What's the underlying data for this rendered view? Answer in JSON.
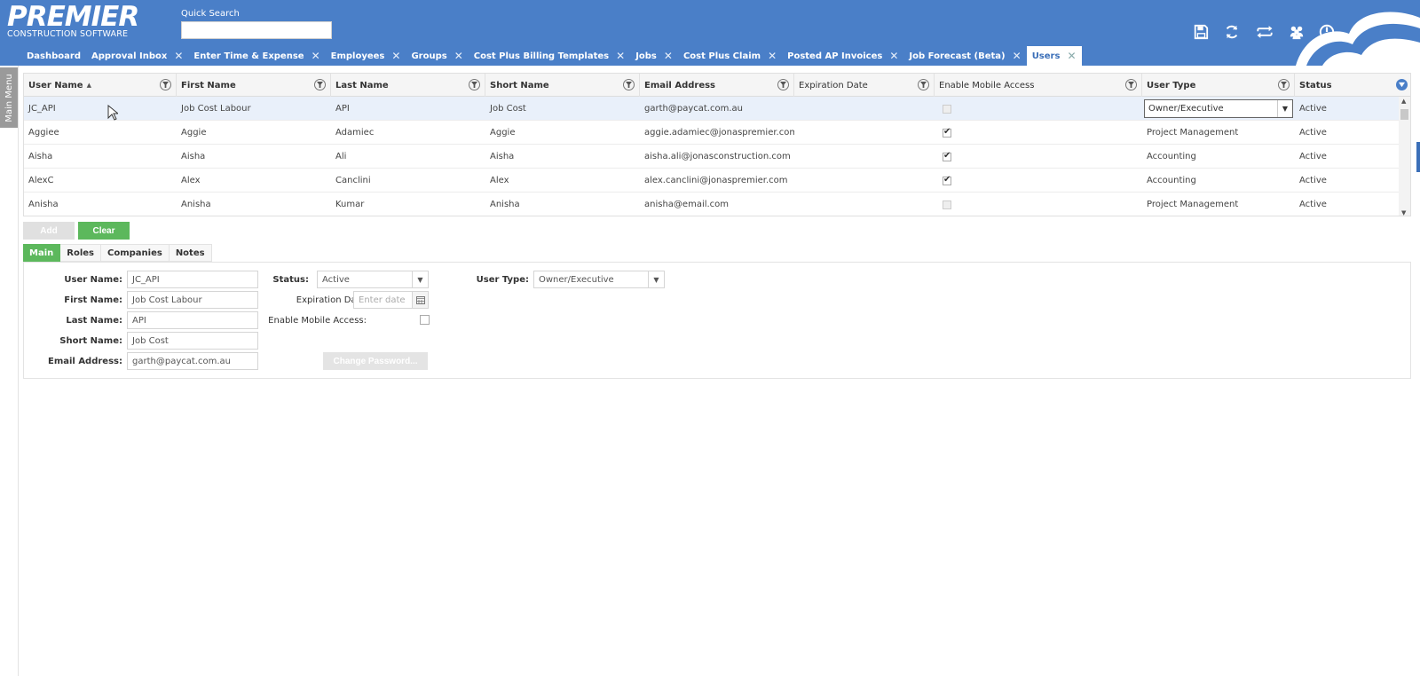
{
  "header": {
    "logo_main": "PREMIER",
    "logo_sub": "CONSTRUCTION SOFTWARE",
    "quick_search_label": "Quick Search",
    "quick_search_value": "",
    "icons": [
      "save-icon",
      "refresh-icon",
      "switch-icon",
      "users-icon",
      "power-icon"
    ],
    "color": "#4a7fc8"
  },
  "tabs": [
    {
      "label": "Dashboard",
      "closable": false
    },
    {
      "label": "Approval Inbox",
      "closable": true
    },
    {
      "label": "Enter Time & Expense",
      "closable": true
    },
    {
      "label": "Employees",
      "closable": true
    },
    {
      "label": "Groups",
      "closable": true
    },
    {
      "label": "Cost Plus Billing Templates",
      "closable": true
    },
    {
      "label": "Jobs",
      "closable": true
    },
    {
      "label": "Cost Plus Claim",
      "closable": true
    },
    {
      "label": "Posted AP Invoices",
      "closable": true
    },
    {
      "label": "Job Forecast (Beta)",
      "closable": true
    },
    {
      "label": "Users",
      "closable": true,
      "active": true
    }
  ],
  "side_menu": {
    "label": "Main Menu"
  },
  "grid": {
    "columns": [
      "User Name",
      "First Name",
      "Last Name",
      "Short Name",
      "Email Address",
      "Expiration Date",
      "Enable Mobile Access",
      "User Type",
      "Status"
    ],
    "sort_indicator": "▲",
    "rows": [
      {
        "user_name": "JC_API",
        "first_name": "Job Cost Labour",
        "last_name": "API",
        "short_name": "Job Cost",
        "email": "garth@paycat.com.au",
        "expiration": "",
        "mobile": false,
        "user_type": "Owner/Executive",
        "status": "Active",
        "selected": true
      },
      {
        "user_name": "Aggiee",
        "first_name": "Aggie",
        "last_name": "Adamiec",
        "short_name": "Aggie",
        "email": "aggie.adamiec@jonaspremier.com",
        "expiration": "",
        "mobile": true,
        "user_type": "Project Management",
        "status": "Active"
      },
      {
        "user_name": "Aisha",
        "first_name": "Aisha",
        "last_name": "Ali",
        "short_name": "Aisha",
        "email": "aisha.ali@jonasconstruction.com",
        "expiration": "",
        "mobile": true,
        "user_type": "Accounting",
        "status": "Active"
      },
      {
        "user_name": "AlexC",
        "first_name": "Alex",
        "last_name": "Canclini",
        "short_name": "Alex",
        "email": "alex.canclini@jonaspremier.com",
        "expiration": "",
        "mobile": true,
        "user_type": "Accounting",
        "status": "Active"
      },
      {
        "user_name": "Anisha",
        "first_name": "Anisha",
        "last_name": "Kumar",
        "short_name": "Anisha",
        "email": "anisha@email.com",
        "expiration": "",
        "mobile": false,
        "user_type": "Project Management",
        "status": "Active"
      }
    ]
  },
  "buttons": {
    "add": "Add",
    "clear": "Clear",
    "change_password": "Change Password..."
  },
  "detail_tabs": [
    "Main",
    "Roles",
    "Companies",
    "Notes"
  ],
  "form": {
    "user_name_label": "User Name:",
    "user_name": "JC_API",
    "first_name_label": "First Name:",
    "first_name": "Job Cost Labour",
    "last_name_label": "Last Name:",
    "last_name": "API",
    "short_name_label": "Short Name:",
    "short_name": "Job Cost",
    "email_label": "Email Address:",
    "email": "garth@paycat.com.au",
    "status_label": "Status:",
    "status": "Active",
    "expiration_label": "Expiration Date:",
    "expiration_placeholder": "Enter date",
    "mobile_label": "Enable Mobile Access:",
    "mobile": false,
    "user_type_label": "User Type:",
    "user_type": "Owner/Executive"
  }
}
